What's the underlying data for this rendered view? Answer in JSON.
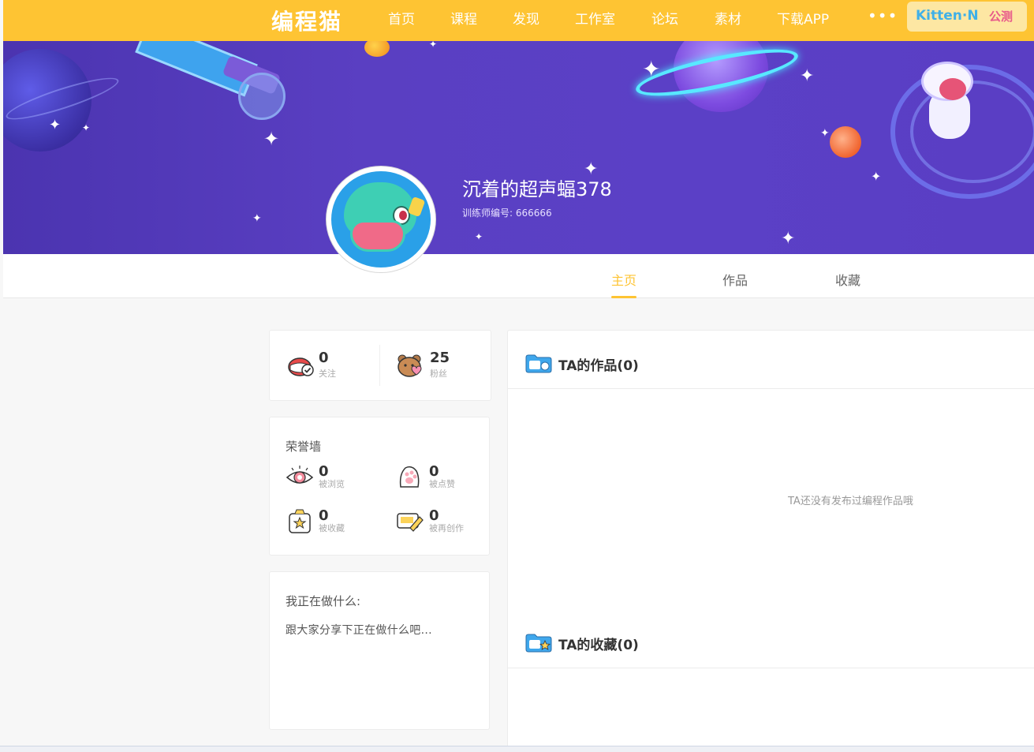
{
  "header": {
    "logo": "编程猫",
    "nav_items": [
      {
        "label": "首页"
      },
      {
        "label": "课程"
      },
      {
        "label": "发现"
      },
      {
        "label": "工作室"
      },
      {
        "label": "论坛"
      },
      {
        "label": "素材"
      },
      {
        "label": "下载APP"
      }
    ],
    "more_label": "•••",
    "kitten_name": "Kitten·N",
    "kitten_tag": "公测",
    "colors": {
      "primary": "#fec433",
      "white": "#ffffff"
    }
  },
  "profile": {
    "username": "沉着的超声蝠378",
    "trainer_id": "训练师编号: 666666"
  },
  "tabs": [
    {
      "label": "主页",
      "active": true
    },
    {
      "label": "作品",
      "active": false
    },
    {
      "label": "收藏",
      "active": false
    }
  ],
  "follow_stats": {
    "following": {
      "value": "0",
      "label": "关注"
    },
    "fans": {
      "value": "25",
      "label": "粉丝"
    }
  },
  "honor_wall": {
    "title": "荣誉墙",
    "items": [
      {
        "value": "0",
        "label": "被浏览",
        "icon": "eye-icon"
      },
      {
        "value": "0",
        "label": "被点赞",
        "icon": "paw-icon"
      },
      {
        "value": "0",
        "label": "被收藏",
        "icon": "star-box-icon"
      },
      {
        "value": "0",
        "label": "被再创作",
        "icon": "edit-card-icon"
      }
    ]
  },
  "doing": {
    "title": "我正在做什么:",
    "text": "跟大家分享下正在做什么吧..."
  },
  "works": {
    "title": "TA的作品(0)",
    "empty_text": "TA还没有发布过编程作品哦"
  },
  "collections": {
    "title": "TA的收藏(0)"
  }
}
